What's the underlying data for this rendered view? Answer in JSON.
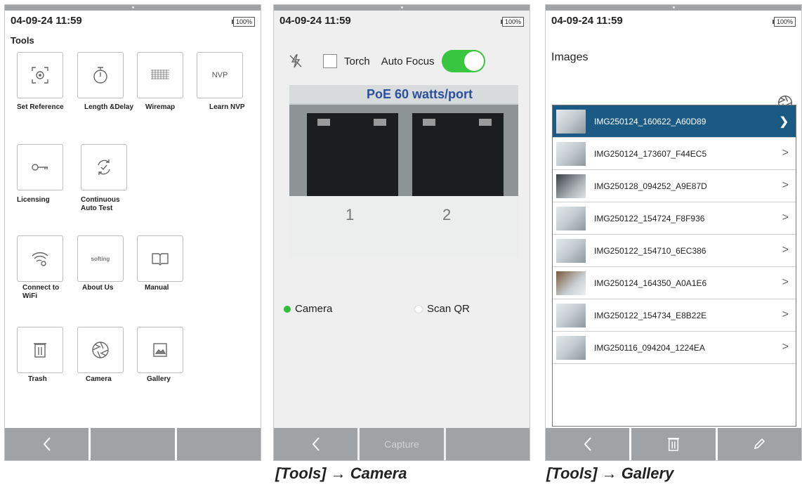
{
  "tools_screen": {
    "status_time": "04-09-24 11:59",
    "battery": "100%",
    "title": "Tools",
    "tiles": [
      {
        "label": "Set Reference",
        "icon": "target-icon"
      },
      {
        "label": "Length &Delay",
        "icon": "stopwatch-icon"
      },
      {
        "label": "Wiremap",
        "icon": "wiremap-icon"
      },
      {
        "label": "Learn NVP",
        "icon": "nvp-icon",
        "icon_text": "NVP"
      },
      {
        "label": "Licensing",
        "icon": "key-icon"
      },
      {
        "label": "Continuous Auto Test",
        "icon": "refresh-check-icon"
      },
      {
        "label": "Connect to WiFi",
        "icon": "wifi-gear-icon"
      },
      {
        "label": "About Us",
        "icon": "logo-icon",
        "icon_text": "softing"
      },
      {
        "label": "Manual",
        "icon": "book-icon"
      },
      {
        "label": "Trash",
        "icon": "trash-icon"
      },
      {
        "label": "Camera",
        "icon": "camera-shutter-icon"
      },
      {
        "label": "Gallery",
        "icon": "image-icon"
      }
    ],
    "nav": {
      "back": "<"
    }
  },
  "camera_screen": {
    "status_time": "04-09-24 11:59",
    "battery": "100%",
    "torch_label": "Torch",
    "autofocus_label": "Auto Focus",
    "autofocus_on": true,
    "preview_text": "PoE 60 watts/port",
    "port_numbers": [
      "1",
      "2"
    ],
    "mode_camera": "Camera",
    "mode_scan": "Scan QR",
    "nav": {
      "back": "<",
      "capture": "Capture"
    },
    "caption": "[Tools] → Camera"
  },
  "gallery_screen": {
    "status_time": "04-09-24 11:59",
    "battery": "100%",
    "title": "Images",
    "images": [
      "IMG250124_160622_A60D89",
      "IMG250124_173607_F44EC5",
      "IMG250128_094252_A9E87D",
      "IMG250122_154724_F8F936",
      "IMG250122_154710_6EC386",
      "IMG250124_164350_A0A1E6",
      "IMG250122_154734_E8B22E",
      "IMG250116_094204_1224EA"
    ],
    "selected_index": 0,
    "nav": {
      "back": "<"
    },
    "caption": "[Tools] → Gallery"
  },
  "colors": {
    "accent_selected": "#1b5a85",
    "toggle_on": "#37c63e",
    "nav_bar": "#9fa3a6",
    "camera_radio": "#2fbf3a"
  }
}
